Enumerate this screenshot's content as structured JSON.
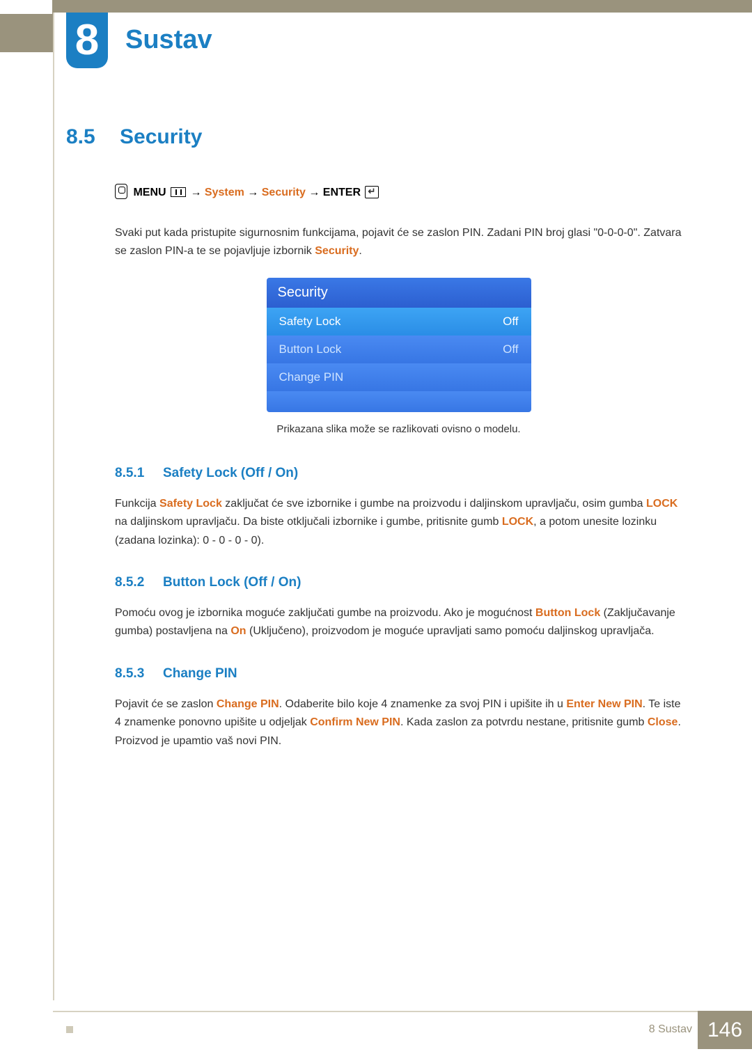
{
  "chapter": {
    "number": "8",
    "title": "Sustav"
  },
  "section": {
    "number": "8.5",
    "title": "Security"
  },
  "menu_path": {
    "menu": "MENU",
    "system": "System",
    "security": "Security",
    "enter": "ENTER",
    "arrow": "→"
  },
  "intro": {
    "pre": "Svaki put kada pristupite sigurnosnim funkcijama, pojavit će se zaslon PIN. Zadani PIN broj glasi \"0-0-0-0\". Zatvara se zaslon PIN-a te se pojavljuje izbornik ",
    "highlight": "Security",
    "post": "."
  },
  "osd": {
    "title": "Security",
    "rows": [
      {
        "label": "Safety Lock",
        "value": "Off"
      },
      {
        "label": "Button Lock",
        "value": "Off"
      },
      {
        "label": "Change PIN",
        "value": ""
      }
    ]
  },
  "caption": "Prikazana slika može se razlikovati ovisno o modelu.",
  "sub1": {
    "num": "8.5.1",
    "title": "Safety Lock (Off / On)",
    "t1": "Funkcija ",
    "h1": "Safety Lock",
    "t2": " zaključat će sve izbornike i gumbe na proizvodu i daljinskom upravljaču, osim gumba ",
    "h2": "LOCK",
    "t3": " na daljinskom upravljaču. Da biste otključali izbornike i gumbe, pritisnite gumb ",
    "h3": "LOCK",
    "t4": ", a potom unesite lozinku (zadana lozinka): 0 - 0 - 0 - 0)."
  },
  "sub2": {
    "num": "8.5.2",
    "title": "Button Lock (Off / On)",
    "t1": "Pomoću ovog je izbornika moguće zaključati gumbe na proizvodu. Ako je mogućnost ",
    "h1": "Button Lock",
    "t2": " (Zaključavanje gumba) postavljena na ",
    "h2": "On",
    "t3": " (Uključeno), proizvodom je moguće upravljati samo pomoću daljinskog upravljača."
  },
  "sub3": {
    "num": "8.5.3",
    "title": "Change PIN",
    "t1": "Pojavit će se zaslon ",
    "h1": "Change PIN",
    "t2": ". Odaberite bilo koje 4 znamenke za svoj PIN i upišite ih u ",
    "h2": "Enter New PIN",
    "t3": ". Te iste 4 znamenke ponovno upišite u odjeljak ",
    "h3": "Confirm New PIN",
    "t4": ". Kada zaslon za potvrdu nestane, pritisnite gumb ",
    "h4": "Close",
    "t5": ". Proizvod je upamtio vaš novi PIN."
  },
  "footer": {
    "label": "8 Sustav",
    "page": "146"
  }
}
